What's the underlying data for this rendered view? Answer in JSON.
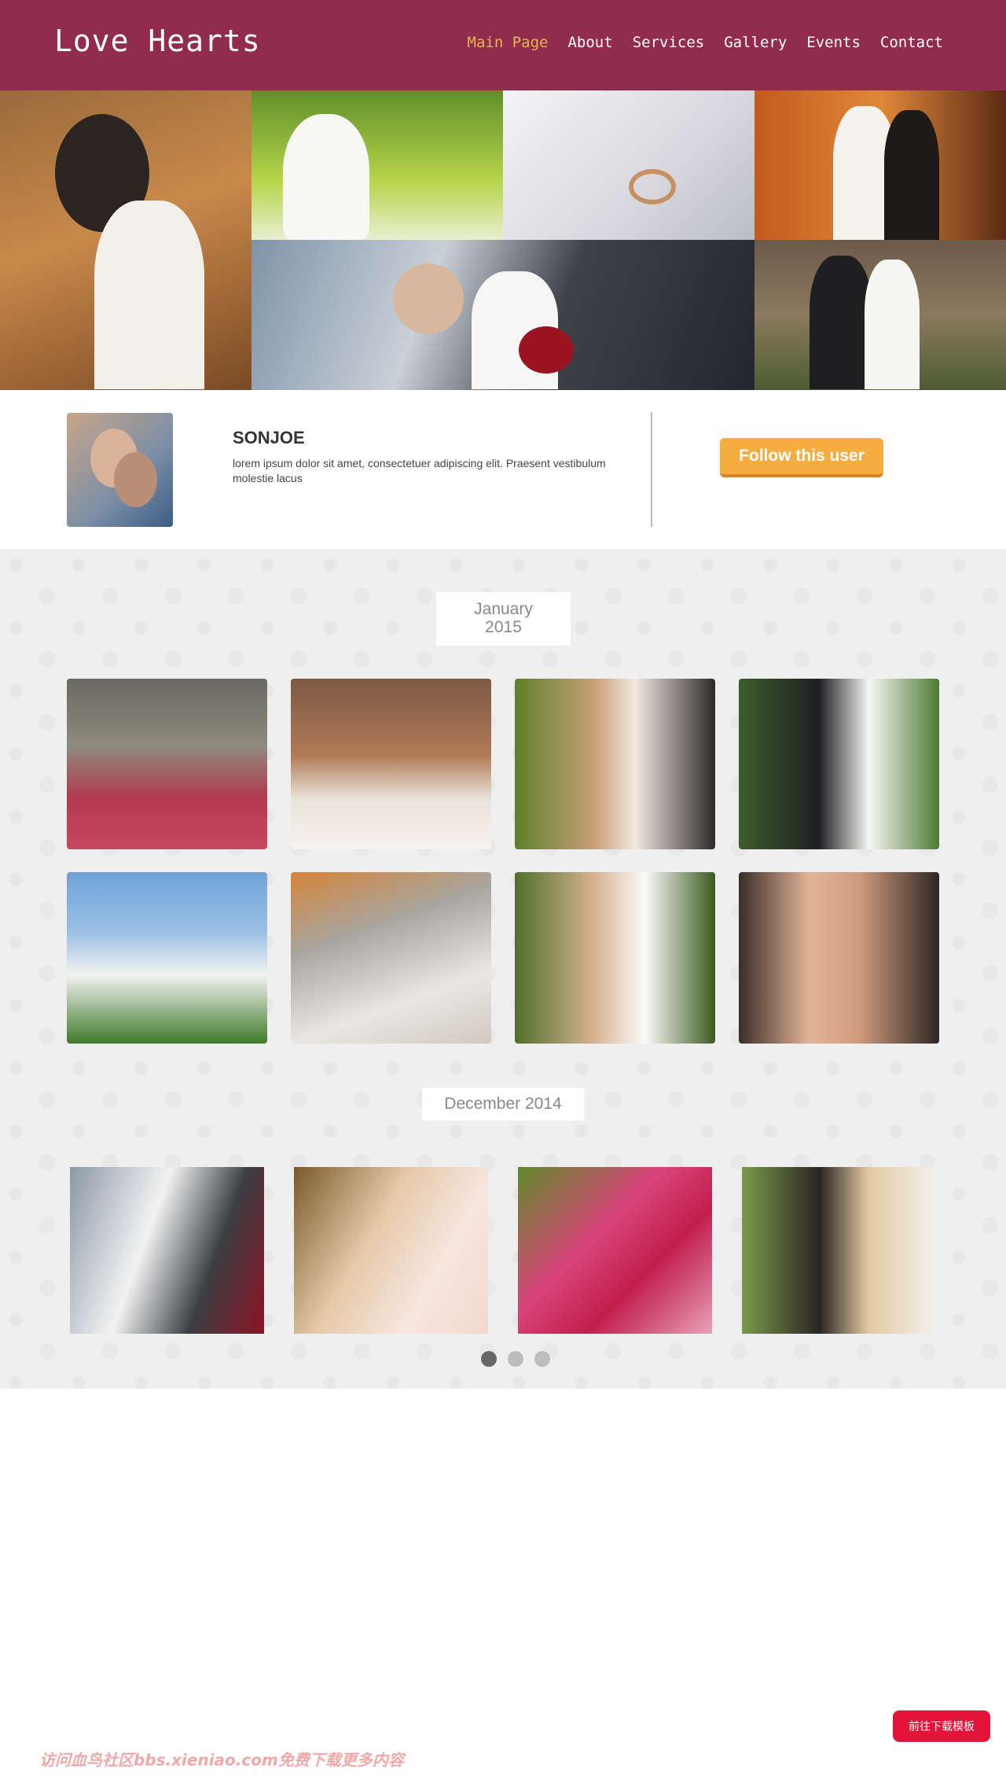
{
  "header": {
    "logo": "Love Hearts",
    "nav": [
      "Main Page",
      "About",
      "Services",
      "Gallery",
      "Events",
      "Contact"
    ],
    "active_color": "#e5b64e",
    "bg_color": "#922c4f"
  },
  "banner": {
    "photos": [
      "couple-autumn-photo",
      "bride-garden-photo",
      "rings-photo",
      "couple-kiss-photo",
      "couple-bouquet-photo",
      "couple-outdoor-photo"
    ]
  },
  "profile": {
    "name": "SONJOE",
    "description": "lorem ipsum dolor sit amet, consectetuer adipiscing elit. Praesent vestibulum molestie lacus",
    "follow_label": "Follow this user"
  },
  "gallery": {
    "sections": [
      {
        "date_line1": "January",
        "date_line2": "2015"
      },
      {
        "date_line1": "December 2014",
        "date_line2": ""
      }
    ],
    "january_photos": [
      "banquet-hall-photo",
      "wedding-car-photo",
      "couple-roses-photo",
      "couple-smiling-photo",
      "flower-arch-photo",
      "cake-toppers-photo",
      "bride-smile-photo",
      "ring-box-photo"
    ],
    "december_photos": [
      "couple-bouquet-photo",
      "bride-portrait-photo",
      "rings-on-roses-photo",
      "couple-embrace-photo"
    ],
    "pager": {
      "pages": 3,
      "current": 1
    }
  },
  "footer": {
    "download_label": "前往下载模板",
    "watermark": "访问血鸟社区bbs.xieniao.com免费下载更多内容"
  }
}
